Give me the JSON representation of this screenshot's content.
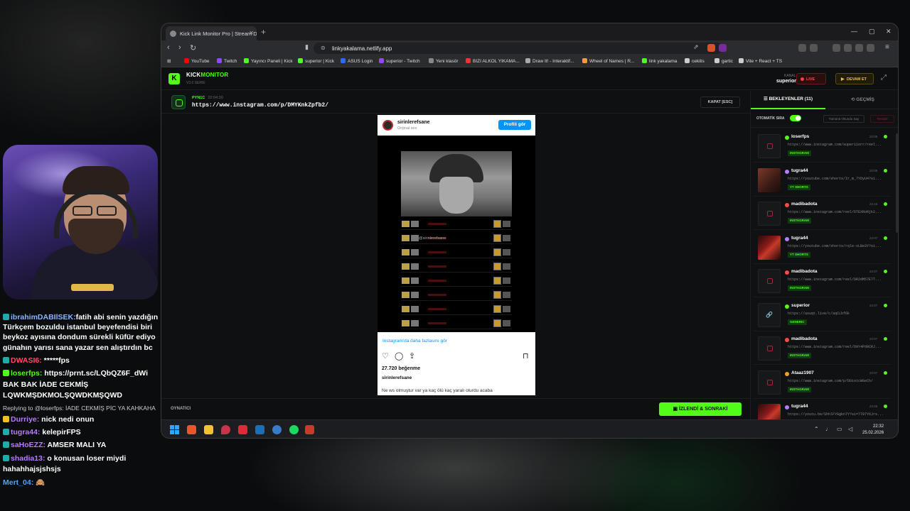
{
  "chat": [
    {
      "user": "ibrahimDABIlSEK:",
      "text": "fatih abi senin yazdığın",
      "color": "#8ab4ff"
    },
    {
      "user": "",
      "text": "Türkçem bozuldu istanbul beyefendisi biri",
      "color": ""
    },
    {
      "user": "",
      "text": "beykoz ayısına dondum sürekli küfür ediyo",
      "color": ""
    },
    {
      "user": "",
      "text": "günahın yarısı sana yazar sen alıştırdın bc",
      "color": ""
    },
    {
      "user": "DWASI6:",
      "text": " *****fps",
      "color": "#ff4a6a"
    },
    {
      "user": "loserfps:",
      "text": " https://prnt.sc/LQbQZ6F_dWi",
      "color": "#53fc18"
    },
    {
      "user": "",
      "text": "BAK BAK İADE CEKMİŞ",
      "color": ""
    },
    {
      "user": "",
      "text": "LQWKMŞDKMOLŞQWDKMŞQWD",
      "color": ""
    },
    {
      "user": "",
      "text": "Replying to @loserfps: İADE CEKMİŞ PİC YA KAHKAHA",
      "color": "reply"
    },
    {
      "user": "Durriye:",
      "text": " nick nedi onun",
      "color": "#b77bff"
    },
    {
      "user": "tugra44:",
      "text": " kelepirFPS",
      "color": "#b77bff"
    },
    {
      "user": "saHoEZZ:",
      "text": " AMSER MALI YA",
      "color": "#b77bff"
    },
    {
      "user": "shadia13:",
      "text": " o konusan loser miydi",
      "color": "#b77bff"
    },
    {
      "user": "",
      "text": "hahahhajsjshsjs",
      "color": ""
    },
    {
      "user": "Mert_04:",
      "text": " 🙈",
      "color": "#4aa3ff"
    }
  ],
  "browser": {
    "tab_title": "Kick Link Monitor Pro | Stream D",
    "url": "linkyakalama.netlify.app",
    "bookmarks": [
      "YouTube",
      "Twitch",
      "Yayıncı Paneli | Kick",
      "superior | Kick",
      "ASUS Login",
      "superior - Twitch",
      "Yeni klasör",
      "BIZI ALKOL YIKAMA...",
      "Draw It! - Interaktif...",
      "Wheel of Names | R...",
      "link yakalama",
      "cekilis",
      "gartic",
      "Vite + React + TS"
    ]
  },
  "app": {
    "brand_a": "KICK",
    "brand_b": "MONITOR",
    "version": "V3.0 SERIE",
    "kanal_label": "KANAL",
    "kanal_value": "superior",
    "live_label": "LIVE",
    "devam_label": "DEVAM ET",
    "player_user": "PYN1C",
    "player_time": "22:04:30",
    "player_url": "https://www.instagram.com/p/DMYKnkZpfb2/",
    "close_label": "KAPAT [ESC]",
    "bottom_label": "OYNATICI",
    "next_label": "İZLENDİ & SONRAKİ"
  },
  "embed": {
    "username": "sirinlerefsane",
    "subtitle": "Orijinal ses",
    "profile_btn": "Profili gör",
    "watermark": "@sirinlerefsane",
    "more_link": "Instagram'da daha fazlasını gör",
    "likes": "27.720 beğenme",
    "caption": "Ne ws olmuştur var ya kaç ölü kaç yaralı olurdu acaba"
  },
  "queue": {
    "tab_waiting": "BEKLEYENLER (11)",
    "tab_history": "GEÇMİŞ",
    "auto_label": "OTOMATİK SIRA",
    "mark_all": "Tümünü Okundu Say",
    "clear": "Temizle",
    "items": [
      {
        "user": "loserfps",
        "time": "22:09",
        "url": "https://www.instagram.com/superiiorr/reel...",
        "tag": "INSTAGRAM",
        "dot": "#53fc18",
        "thumb": "ig"
      },
      {
        "user": "tugra44",
        "time": "22:09",
        "url": "https://youtube.com/shorts/Ir_m_7YDyU4?si...",
        "tag": "YT SHORTS",
        "dot": "#b77bff",
        "thumb": "img"
      },
      {
        "user": "madibadota",
        "time": "22:16",
        "url": "https://www.instagram.com/reel/DTEXRoRjk2...",
        "tag": "INSTAGRAM",
        "dot": "#ff4a4a",
        "thumb": "ig"
      },
      {
        "user": "tugra44",
        "time": "22:07",
        "url": "https://youtube.com/shorts/rqle-xLBe3Y?si...",
        "tag": "YT SHORTS",
        "dot": "#b77bff",
        "thumb": "img2"
      },
      {
        "user": "madibadota",
        "time": "22:07",
        "url": "https://www.instagram.com/reel/DR2dM57E7T...",
        "tag": "INSTAGRAM",
        "dot": "#ff4a4a",
        "thumb": "ig"
      },
      {
        "user": "superior",
        "time": "22:07",
        "url": "https://asuqt.live/c/aqCLbf6k",
        "tag": "GENERIC",
        "dot": "#53fc18",
        "thumb": "link"
      },
      {
        "user": "madibadota",
        "time": "22:07",
        "url": "https://www.instagram.com/reel/D0Y4Pd9CRJ...",
        "tag": "INSTAGRAM",
        "dot": "#ff4a4a",
        "thumb": "ig"
      },
      {
        "user": "Ataaz1907",
        "time": "22:07",
        "url": "https://www.instagram.com/p/DOistcWGeCh/",
        "tag": "INSTAGRAM",
        "dot": "#f0a020",
        "thumb": "ig"
      },
      {
        "user": "tugra44",
        "time": "22:06",
        "url": "https://youtu.be/ShhlFYGgkn7Y?si=7797Y6Jrs...",
        "tag": "YT SHORTS",
        "dot": "#b77bff",
        "thumb": "img2"
      }
    ]
  },
  "taskbar": {
    "time": "22:32",
    "date": "25.02.2026"
  }
}
